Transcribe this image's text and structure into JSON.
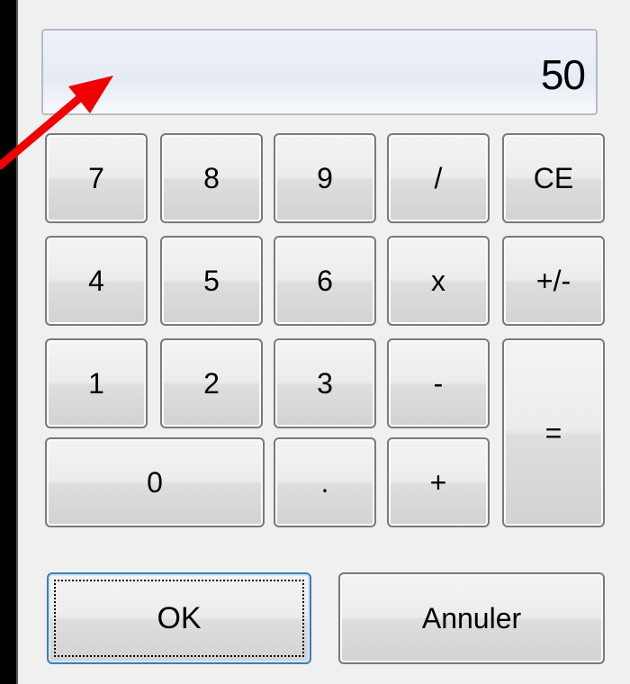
{
  "display": {
    "value": "50"
  },
  "keypad": {
    "k7": "7",
    "k8": "8",
    "k9": "9",
    "div": "/",
    "ce": "CE",
    "k4": "4",
    "k5": "5",
    "k6": "6",
    "mul": "x",
    "neg": "+/-",
    "k1": "1",
    "k2": "2",
    "k3": "3",
    "sub": "-",
    "eq": "=",
    "k0": "0",
    "dot": ".",
    "add": "+"
  },
  "actions": {
    "ok": "OK",
    "cancel": "Annuler"
  },
  "annotation": {
    "arrow_color": "#f00000"
  }
}
